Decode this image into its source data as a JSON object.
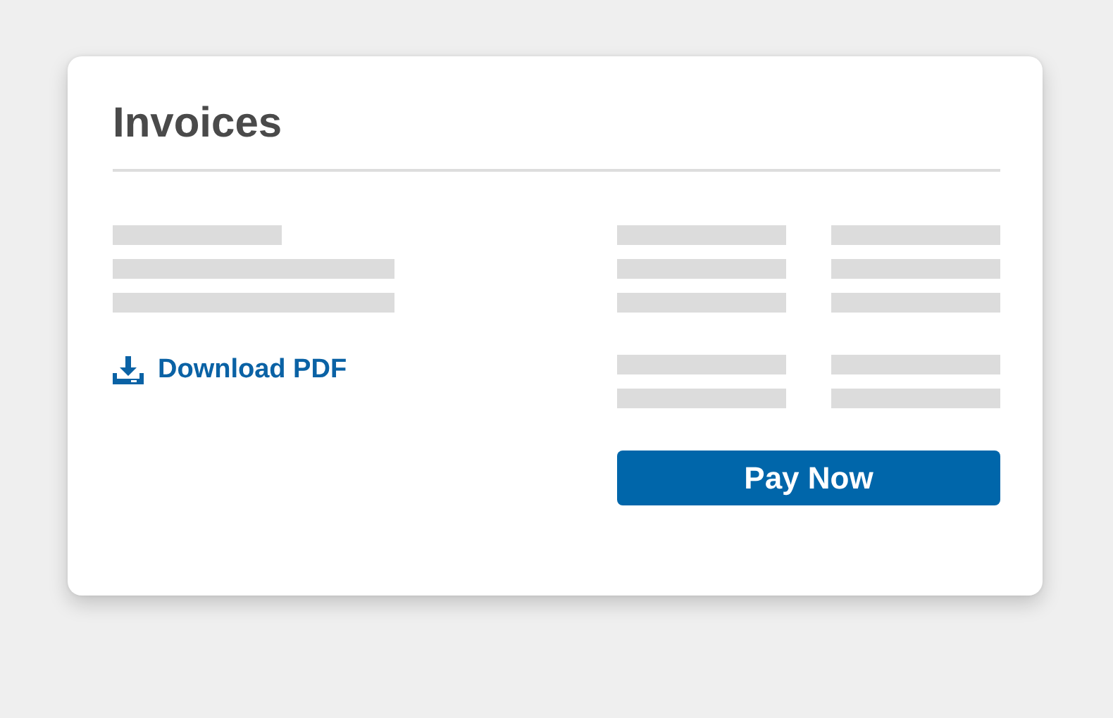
{
  "card": {
    "title": "Invoices"
  },
  "download_link": {
    "label": "Download PDF"
  },
  "pay_button": {
    "label": "Pay Now"
  }
}
